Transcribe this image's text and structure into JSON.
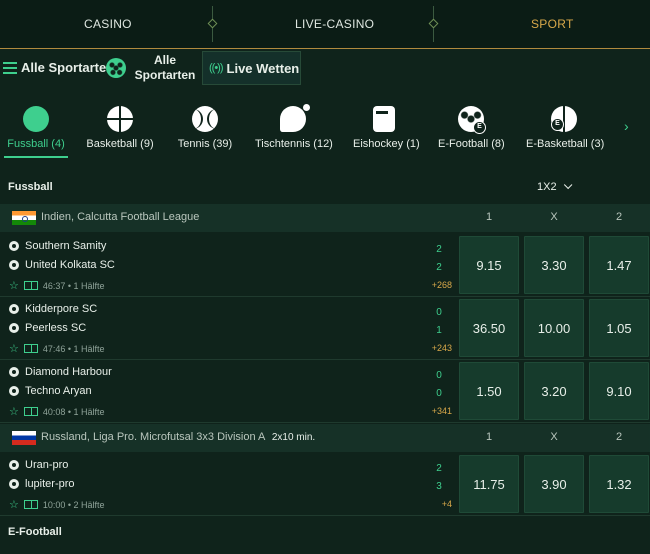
{
  "topnav": {
    "tabs": [
      {
        "label": "CASINO",
        "active": false
      },
      {
        "label": "LIVE-CASINO",
        "active": false
      },
      {
        "label": "SPORT",
        "active": true
      }
    ]
  },
  "subnav": {
    "all_sports_label": "Alle Sportarten",
    "alle_sportarten_tab": "Alle Sportarten",
    "live_label": "Live Wetten"
  },
  "sports": [
    {
      "label": "Fussball (4)",
      "icon": "football-icon",
      "active": true
    },
    {
      "label": "Basketball (9)",
      "icon": "basketball-icon",
      "active": false
    },
    {
      "label": "Tennis (39)",
      "icon": "tennis-icon",
      "active": false
    },
    {
      "label": "Tischtennis (12)",
      "icon": "table-tennis-icon",
      "active": false
    },
    {
      "label": "Eishockey (1)",
      "icon": "ice-hockey-icon",
      "active": false
    },
    {
      "label": "E-Football (8)",
      "icon": "efootball-icon",
      "active": false
    },
    {
      "label": "E-Basketball (3)",
      "icon": "ebasketball-icon",
      "active": false
    }
  ],
  "section": {
    "title": "Fussball",
    "market": "1X2"
  },
  "leagues": [
    {
      "name": "Indien, Calcutta Football League",
      "extra": "",
      "cols": [
        "1",
        "X",
        "2"
      ],
      "matches": [
        {
          "home": "Southern Samity",
          "away": "United Kolkata SC",
          "home_score": "2",
          "away_score": "2",
          "time": "46:37 • 1 Hälfte",
          "more": "+268",
          "odds": [
            "9.15",
            "3.30",
            "1.47"
          ]
        },
        {
          "home": "Kidderpore SC",
          "away": "Peerless SC",
          "home_score": "0",
          "away_score": "1",
          "time": "47:46 • 1 Hälfte",
          "more": "+243",
          "odds": [
            "36.50",
            "10.00",
            "1.05"
          ]
        },
        {
          "home": "Diamond Harbour",
          "away": "Techno Aryan",
          "home_score": "0",
          "away_score": "0",
          "time": "40:08 • 1 Hälfte",
          "more": "+341",
          "odds": [
            "1.50",
            "3.20",
            "9.10"
          ]
        }
      ]
    },
    {
      "name": "Russland, Liga Pro. Microfutsal 3x3 Division A",
      "extra": "2x10 min.",
      "cols": [
        "1",
        "X",
        "2"
      ],
      "matches": [
        {
          "home": "Uran-pro",
          "away": "lupiter-pro",
          "home_score": "2",
          "away_score": "3",
          "time": "10:00 • 2 Hälfte",
          "more": "+4",
          "odds": [
            "11.75",
            "3.90",
            "1.32"
          ]
        }
      ]
    }
  ],
  "bottom_section": {
    "title": "E-Football"
  },
  "colors": {
    "accent": "#3ecf8e",
    "gold": "#d8a84a",
    "background": "#0f231b"
  }
}
